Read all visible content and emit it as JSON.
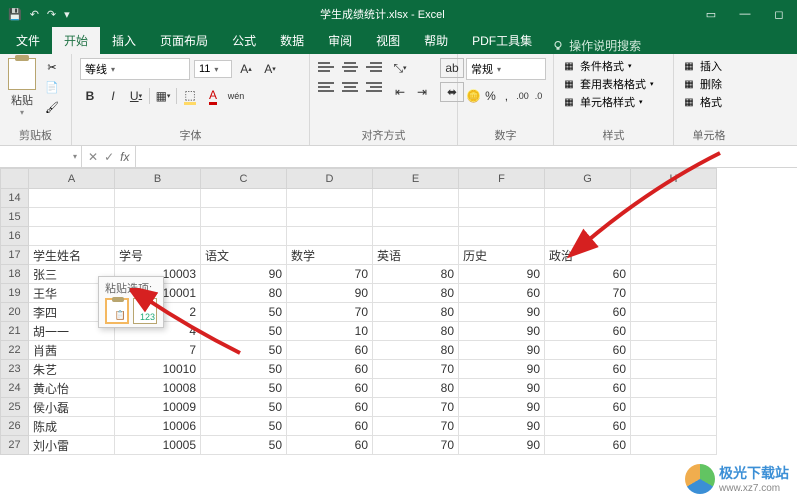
{
  "titlebar": {
    "title": "学生成绩统计.xlsx - Excel"
  },
  "tabs": {
    "file": "文件",
    "home": "开始",
    "insert": "插入",
    "layout": "页面布局",
    "formulas": "公式",
    "data": "数据",
    "review": "审阅",
    "view": "视图",
    "help": "帮助",
    "pdf": "PDF工具集",
    "tellme": "操作说明搜索"
  },
  "ribbon": {
    "clipboard": {
      "paste": "粘贴",
      "label": "剪贴板"
    },
    "font": {
      "name": "等线",
      "size": "11",
      "label": "字体"
    },
    "align": {
      "label": "对齐方式",
      "wrap": "ab"
    },
    "number": {
      "format": "常规",
      "label": "数字"
    },
    "styles": {
      "cond": "条件格式",
      "table": "套用表格格式",
      "cell": "单元格样式",
      "label": "样式"
    },
    "cells": {
      "insert": "插入",
      "delete": "删除",
      "format": "格式",
      "label": "单元格"
    }
  },
  "formula_bar": {
    "name_box": "",
    "fx": "fx"
  },
  "paste_popup": {
    "title": "粘贴选项:"
  },
  "columns": [
    "A",
    "B",
    "C",
    "D",
    "E",
    "F",
    "G",
    "H"
  ],
  "rows": [
    {
      "n": "14",
      "cells": [
        "",
        "",
        "",
        "",
        "",
        "",
        "",
        ""
      ]
    },
    {
      "n": "15",
      "cells": [
        "",
        "",
        "",
        "",
        "",
        "",
        "",
        ""
      ]
    },
    {
      "n": "16",
      "cells": [
        "",
        "",
        "",
        "",
        "",
        "",
        "",
        ""
      ]
    },
    {
      "n": "17",
      "cells": [
        "学生姓名",
        "学号",
        "语文",
        "数学",
        "英语",
        "历史",
        "政治",
        ""
      ]
    },
    {
      "n": "18",
      "cells": [
        "张三",
        "10003",
        "90",
        "70",
        "80",
        "90",
        "60",
        ""
      ]
    },
    {
      "n": "19",
      "cells": [
        "王华",
        "10001",
        "80",
        "90",
        "80",
        "60",
        "70",
        ""
      ]
    },
    {
      "n": "20",
      "cells": [
        "李四",
        "2",
        "50",
        "70",
        "80",
        "90",
        "60",
        ""
      ]
    },
    {
      "n": "21",
      "cells": [
        "胡一一",
        "4",
        "50",
        "10",
        "80",
        "90",
        "60",
        ""
      ]
    },
    {
      "n": "22",
      "cells": [
        "肖茜",
        "7",
        "50",
        "60",
        "80",
        "90",
        "60",
        ""
      ]
    },
    {
      "n": "23",
      "cells": [
        "朱艺",
        "10010",
        "50",
        "60",
        "70",
        "90",
        "60",
        ""
      ]
    },
    {
      "n": "24",
      "cells": [
        "黄心怡",
        "10008",
        "50",
        "60",
        "80",
        "90",
        "60",
        ""
      ]
    },
    {
      "n": "25",
      "cells": [
        "侯小磊",
        "10009",
        "50",
        "60",
        "70",
        "90",
        "60",
        ""
      ]
    },
    {
      "n": "26",
      "cells": [
        "陈成",
        "10006",
        "50",
        "60",
        "70",
        "90",
        "60",
        ""
      ]
    },
    {
      "n": "27",
      "cells": [
        "刘小雷",
        "10005",
        "50",
        "60",
        "70",
        "90",
        "60",
        ""
      ]
    }
  ],
  "header_row_index": 3,
  "watermark": {
    "main": "极光下载站",
    "sub": "www.xz7.com"
  }
}
